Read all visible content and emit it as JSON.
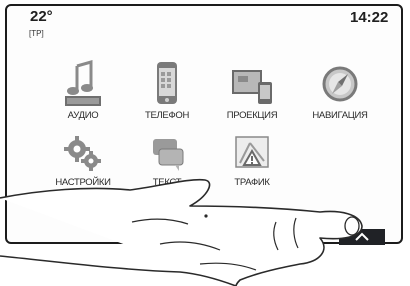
{
  "status": {
    "temperature": "22°",
    "traffic_tag": "[TP]",
    "time": "14:22"
  },
  "apps": [
    {
      "label": "АУДИО",
      "icon": "music-note-icon"
    },
    {
      "label": "ТЕЛЕФОН",
      "icon": "phone-icon"
    },
    {
      "label": "ПРОЕКЦИЯ",
      "icon": "projection-icon"
    },
    {
      "label": "НАВИГАЦИЯ",
      "icon": "compass-icon"
    },
    {
      "label": "НАСТРОЙКИ",
      "icon": "gears-icon"
    },
    {
      "label": "ТЕКСТ",
      "icon": "chat-bubbles-icon"
    },
    {
      "label": "ТРАФИК",
      "icon": "traffic-warning-icon"
    }
  ],
  "drawer": {
    "icon": "chevron-up-icon"
  },
  "gesture": {
    "icon": "swipe-hand-icon"
  },
  "colors": {
    "frame": "#1c1c1c",
    "icon_gray": "#8a8a8a",
    "handle": "#202226"
  }
}
